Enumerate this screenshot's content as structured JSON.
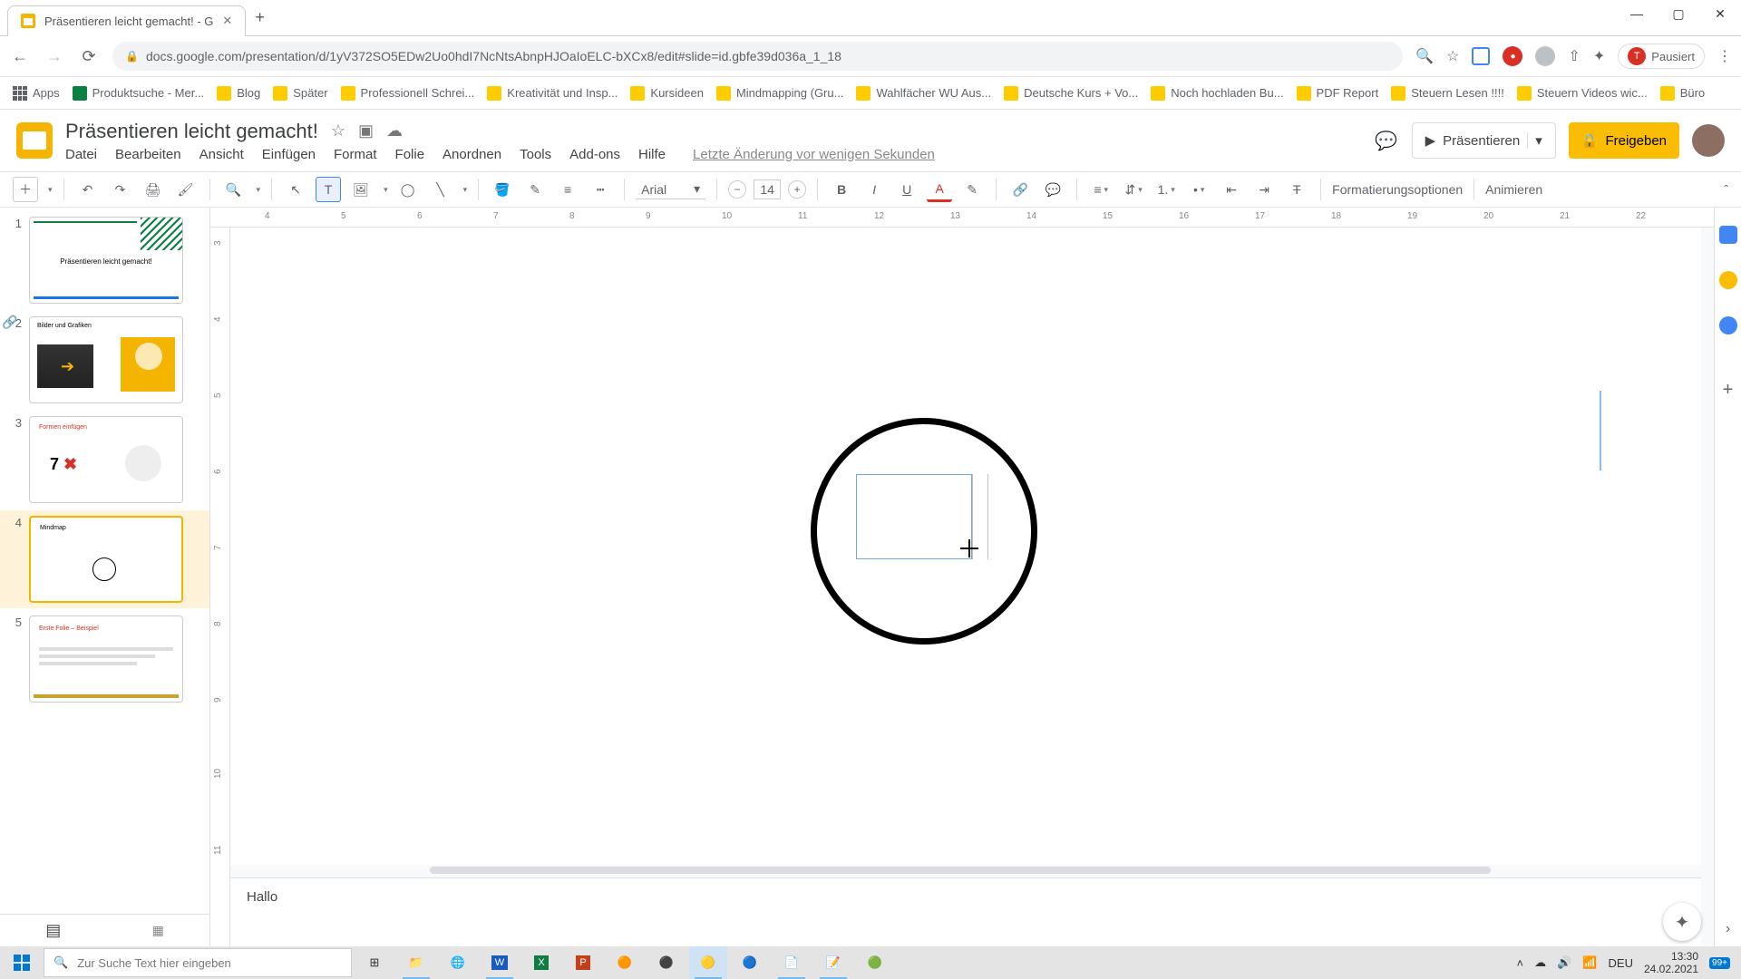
{
  "browser": {
    "tab_title": "Präsentieren leicht gemacht! - G",
    "url": "docs.google.com/presentation/d/1yV372SO5EDw2Uo0hdI7NcNtsAbnpHJOaIoELC-bXCx8/edit#slide=id.gbfe39d036a_1_18",
    "paused_label": "Pausiert"
  },
  "bookmarks": [
    "Apps",
    "Produktsuche - Mer...",
    "Blog",
    "Später",
    "Professionell Schrei...",
    "Kreativität und Insp...",
    "Kursideen",
    "Mindmapping  (Gru...",
    "Wahlfächer WU Aus...",
    "Deutsche Kurs + Vo...",
    "Noch hochladen Bu...",
    "PDF Report",
    "Steuern Lesen !!!!",
    "Steuern Videos wic...",
    "Büro"
  ],
  "doc": {
    "title": "Präsentieren leicht gemacht!",
    "last_change": "Letzte Änderung vor wenigen Sekunden"
  },
  "menu": [
    "Datei",
    "Bearbeiten",
    "Ansicht",
    "Einfügen",
    "Format",
    "Folie",
    "Anordnen",
    "Tools",
    "Add-ons",
    "Hilfe"
  ],
  "header_buttons": {
    "present": "Präsentieren",
    "share": "Freigeben"
  },
  "toolbar": {
    "font": "Arial",
    "size": "14",
    "format_options": "Formatierungsoptionen",
    "animate": "Animieren"
  },
  "hruler_ticks": [
    "4",
    "5",
    "6",
    "7",
    "8",
    "9",
    "10",
    "11",
    "12",
    "13",
    "14",
    "15",
    "16",
    "17",
    "18",
    "19",
    "20",
    "21",
    "22"
  ],
  "vruler_ticks": [
    "3",
    "4",
    "5",
    "6",
    "7",
    "8",
    "9",
    "10",
    "11"
  ],
  "thumbs": [
    {
      "n": "1",
      "title": "Präsentieren leicht gemacht!"
    },
    {
      "n": "2",
      "title": "Bilder und Grafiken"
    },
    {
      "n": "3",
      "title": "Formen einfügen",
      "badge": "7 ✖"
    },
    {
      "n": "4",
      "title": "Mindmap"
    },
    {
      "n": "5",
      "title": "Erste Folie – Beispiel"
    }
  ],
  "speaker_notes": "Hallo",
  "taskbar": {
    "search_placeholder": "Zur Suche Text hier eingeben",
    "lang": "DEU",
    "time": "13:30",
    "date": "24.02.2021",
    "notif_badge": "99+"
  }
}
